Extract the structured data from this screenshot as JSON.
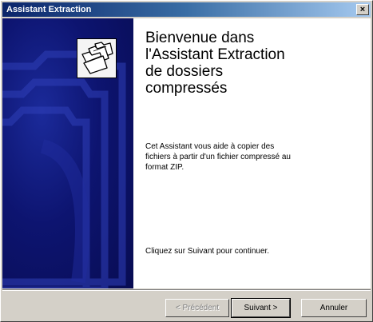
{
  "window": {
    "title": "Assistant Extraction",
    "close_glyph": "×"
  },
  "welcome": {
    "heading_lines": [
      "Bienvenue dans",
      "l'Assistant Extraction",
      "de dossiers",
      "compressés"
    ],
    "description_lines": [
      "Cet Assistant vous aide à copier des",
      "fichiers à partir d'un fichier compressé au",
      "format ZIP."
    ],
    "continue_text": "Cliquez sur Suivant pour continuer."
  },
  "buttons": {
    "back": "< Précédent",
    "next": "Suivant >",
    "cancel": "Annuler"
  },
  "colors": {
    "title_start": "#0a246a",
    "title_end": "#a6caf0",
    "banner": "#0d1470",
    "face": "#d4d0c8"
  },
  "icons": {
    "logo": "folders-icon",
    "close": "close-icon"
  }
}
